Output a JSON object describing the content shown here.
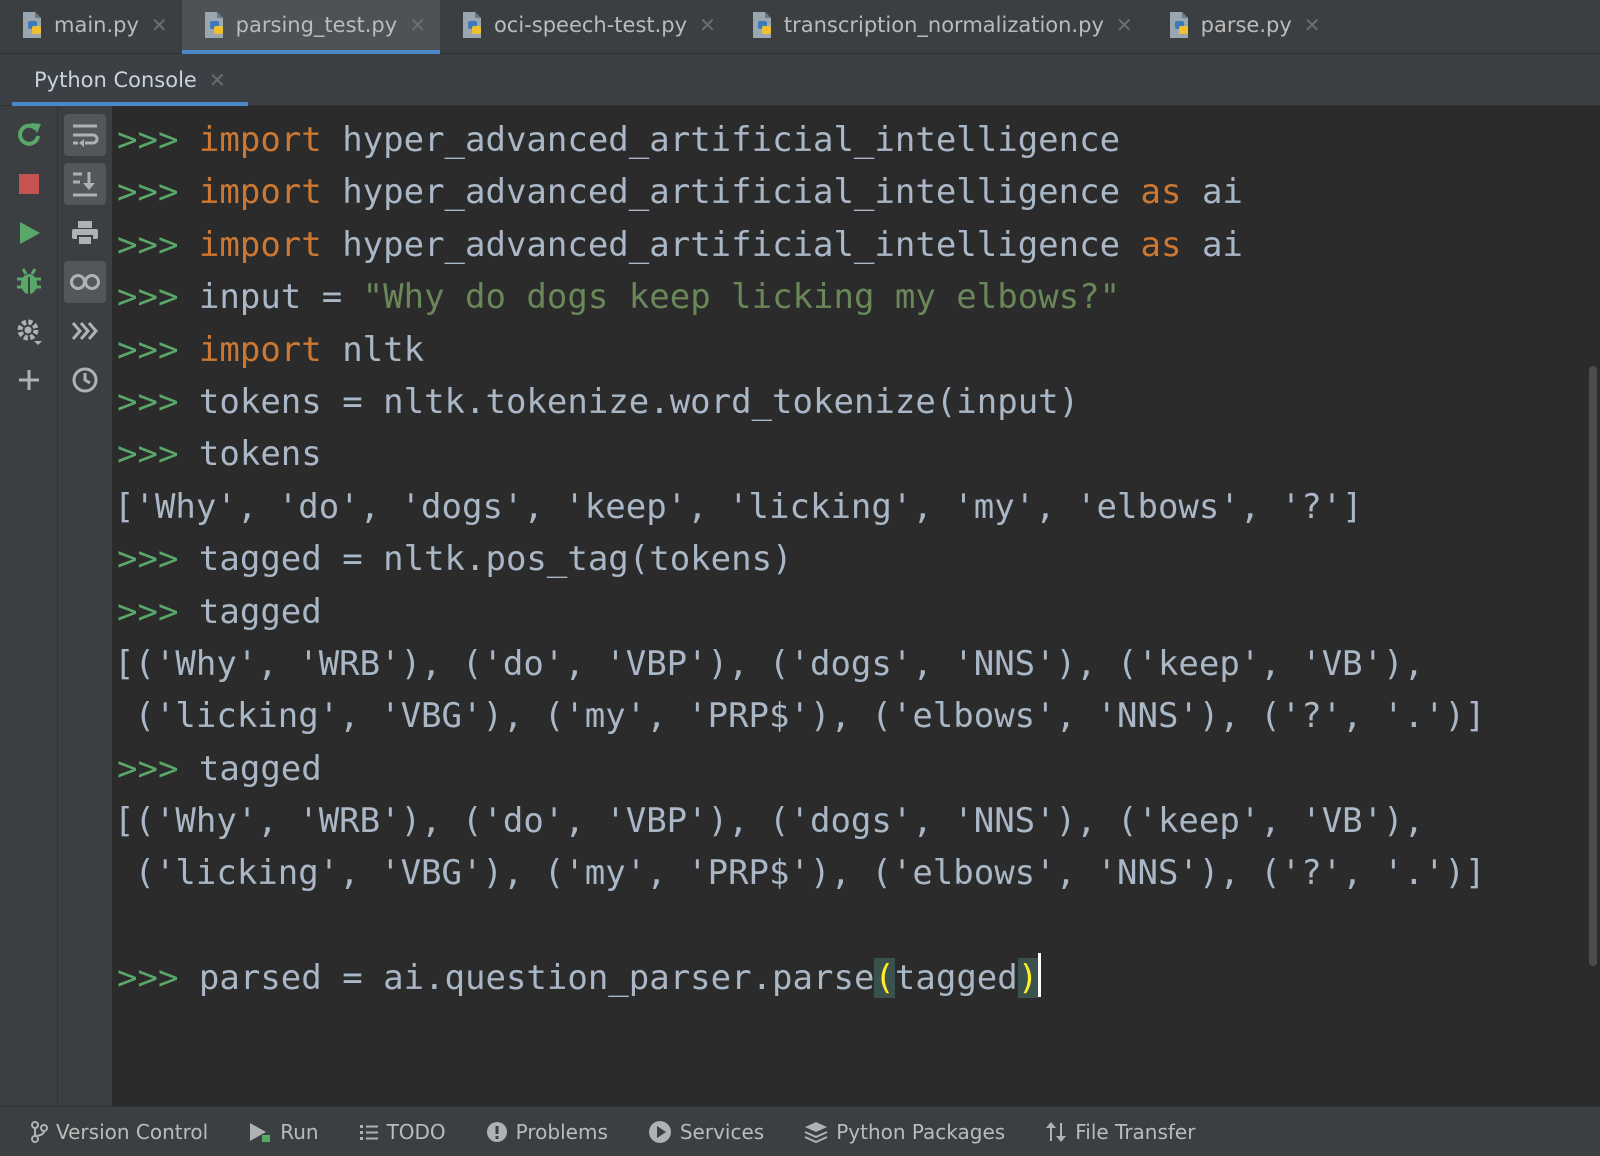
{
  "editor_tabs": [
    {
      "label": "main.py",
      "icon": "python-file-icon",
      "active": false
    },
    {
      "label": "parsing_test.py",
      "icon": "python-file-icon",
      "active": true
    },
    {
      "label": "oci-speech-test.py",
      "icon": "python-file-icon",
      "active": false
    },
    {
      "label": "transcription_normalization.py",
      "icon": "python-file-icon",
      "active": false
    },
    {
      "label": "parse.py",
      "icon": "python-file-icon",
      "active": false
    }
  ],
  "console_tab": {
    "label": "Python Console"
  },
  "toolbar_left": [
    "rerun-icon",
    "stop-icon",
    "run-icon",
    "debug-icon",
    "settings-icon",
    "add-icon"
  ],
  "toolbar_right": [
    "soft-wrap-icon",
    "scroll-to-end-icon",
    "print-icon",
    "show-variables-icon",
    "execute-icon",
    "history-icon"
  ],
  "console": {
    "prompt": ">>>",
    "lines": [
      {
        "type": "input",
        "parts": [
          [
            "kw",
            "import"
          ],
          [
            "plain",
            " hyper_advanced_artificial_intelligence"
          ]
        ]
      },
      {
        "type": "input",
        "parts": [
          [
            "kw",
            "import"
          ],
          [
            "plain",
            " hyper_advanced_artificial_intelligence "
          ],
          [
            "kw",
            "as"
          ],
          [
            "plain",
            " ai"
          ]
        ]
      },
      {
        "type": "input",
        "parts": [
          [
            "kw",
            "import"
          ],
          [
            "plain",
            " hyper_advanced_artificial_intelligence "
          ],
          [
            "kw",
            "as"
          ],
          [
            "plain",
            " ai"
          ]
        ]
      },
      {
        "type": "input",
        "parts": [
          [
            "plain",
            "input = "
          ],
          [
            "str",
            "\"Why do dogs keep licking my elbows?\""
          ]
        ]
      },
      {
        "type": "input",
        "parts": [
          [
            "kw",
            "import"
          ],
          [
            "plain",
            " nltk"
          ]
        ]
      },
      {
        "type": "input",
        "parts": [
          [
            "plain",
            "tokens = nltk.tokenize.word_tokenize(input)"
          ]
        ]
      },
      {
        "type": "input",
        "parts": [
          [
            "plain",
            "tokens"
          ]
        ]
      },
      {
        "type": "output",
        "text": "['Why', 'do', 'dogs', 'keep', 'licking', 'my', 'elbows', '?']"
      },
      {
        "type": "input",
        "parts": [
          [
            "plain",
            "tagged = nltk.pos_tag(tokens)"
          ]
        ]
      },
      {
        "type": "input",
        "parts": [
          [
            "plain",
            "tagged"
          ]
        ]
      },
      {
        "type": "output",
        "text": "[('Why', 'WRB'), ('do', 'VBP'), ('dogs', 'NNS'), ('keep', 'VB'),"
      },
      {
        "type": "output",
        "text": " ('licking', 'VBG'), ('my', 'PRP$'), ('elbows', 'NNS'), ('?', '.')]"
      },
      {
        "type": "input",
        "parts": [
          [
            "plain",
            "tagged"
          ]
        ]
      },
      {
        "type": "output",
        "text": "[('Why', 'WRB'), ('do', 'VBP'), ('dogs', 'NNS'), ('keep', 'VB'),"
      },
      {
        "type": "output",
        "text": " ('licking', 'VBG'), ('my', 'PRP$'), ('elbows', 'NNS'), ('?', '.')]"
      },
      {
        "type": "blank"
      },
      {
        "type": "input",
        "parts": [
          [
            "plain",
            "parsed = ai.question_parser.parse"
          ],
          [
            "brace",
            "("
          ],
          [
            "plain",
            "tagged"
          ],
          [
            "brace",
            ")"
          ],
          [
            "caret",
            ""
          ]
        ]
      }
    ]
  },
  "bottom_bar": [
    {
      "label": "Version Control",
      "icon": "vcs-branch-icon"
    },
    {
      "label": "Run",
      "icon": "run-icon"
    },
    {
      "label": "TODO",
      "icon": "list-icon"
    },
    {
      "label": "Problems",
      "icon": "problems-icon"
    },
    {
      "label": "Services",
      "icon": "services-icon"
    },
    {
      "label": "Python Packages",
      "icon": "layers-icon"
    },
    {
      "label": "File Transfer",
      "icon": "transfer-icon"
    }
  ],
  "colors": {
    "background": "#2b2b2b",
    "keyword": "#cc7832",
    "string": "#6a8759",
    "prompt": "#59a869",
    "text": "#a9b7c6",
    "accent": "#4a88c7"
  }
}
